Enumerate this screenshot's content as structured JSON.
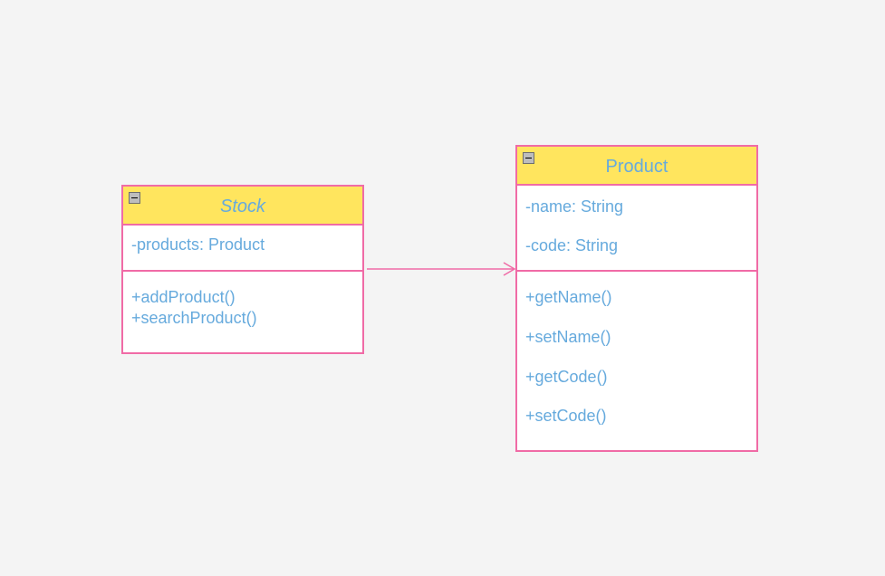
{
  "colors": {
    "background": "#f4f4f4",
    "header_fill": "#ffe55e",
    "border": "#f06ba6",
    "text": "#66aadd"
  },
  "classes": {
    "stock": {
      "name": "Stock",
      "abstract": true,
      "attributes": [
        "-products: Product"
      ],
      "methods": [
        "+addProduct()",
        "+searchProduct()"
      ]
    },
    "product": {
      "name": "Product",
      "abstract": false,
      "attributes": [
        "-name: String",
        "-code: String"
      ],
      "methods": [
        "+getName()",
        "+setName()",
        "+getCode()",
        "+setCode()"
      ]
    }
  },
  "relations": [
    {
      "from": "Stock",
      "to": "Product",
      "type": "association",
      "arrow": "open"
    }
  ]
}
